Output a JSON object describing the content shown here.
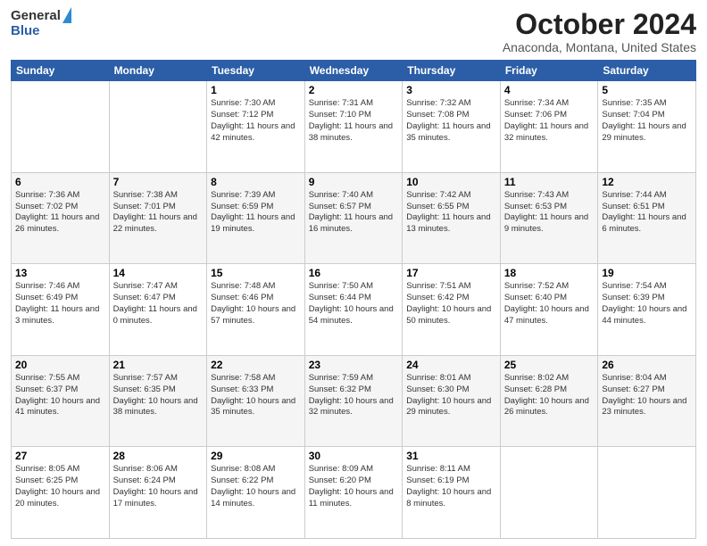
{
  "header": {
    "logo_general": "General",
    "logo_blue": "Blue",
    "title": "October 2024",
    "subtitle": "Anaconda, Montana, United States"
  },
  "days_of_week": [
    "Sunday",
    "Monday",
    "Tuesday",
    "Wednesday",
    "Thursday",
    "Friday",
    "Saturday"
  ],
  "weeks": [
    [
      {
        "day": "",
        "info": ""
      },
      {
        "day": "",
        "info": ""
      },
      {
        "day": "1",
        "info": "Sunrise: 7:30 AM\nSunset: 7:12 PM\nDaylight: 11 hours and 42 minutes."
      },
      {
        "day": "2",
        "info": "Sunrise: 7:31 AM\nSunset: 7:10 PM\nDaylight: 11 hours and 38 minutes."
      },
      {
        "day": "3",
        "info": "Sunrise: 7:32 AM\nSunset: 7:08 PM\nDaylight: 11 hours and 35 minutes."
      },
      {
        "day": "4",
        "info": "Sunrise: 7:34 AM\nSunset: 7:06 PM\nDaylight: 11 hours and 32 minutes."
      },
      {
        "day": "5",
        "info": "Sunrise: 7:35 AM\nSunset: 7:04 PM\nDaylight: 11 hours and 29 minutes."
      }
    ],
    [
      {
        "day": "6",
        "info": "Sunrise: 7:36 AM\nSunset: 7:02 PM\nDaylight: 11 hours and 26 minutes."
      },
      {
        "day": "7",
        "info": "Sunrise: 7:38 AM\nSunset: 7:01 PM\nDaylight: 11 hours and 22 minutes."
      },
      {
        "day": "8",
        "info": "Sunrise: 7:39 AM\nSunset: 6:59 PM\nDaylight: 11 hours and 19 minutes."
      },
      {
        "day": "9",
        "info": "Sunrise: 7:40 AM\nSunset: 6:57 PM\nDaylight: 11 hours and 16 minutes."
      },
      {
        "day": "10",
        "info": "Sunrise: 7:42 AM\nSunset: 6:55 PM\nDaylight: 11 hours and 13 minutes."
      },
      {
        "day": "11",
        "info": "Sunrise: 7:43 AM\nSunset: 6:53 PM\nDaylight: 11 hours and 9 minutes."
      },
      {
        "day": "12",
        "info": "Sunrise: 7:44 AM\nSunset: 6:51 PM\nDaylight: 11 hours and 6 minutes."
      }
    ],
    [
      {
        "day": "13",
        "info": "Sunrise: 7:46 AM\nSunset: 6:49 PM\nDaylight: 11 hours and 3 minutes."
      },
      {
        "day": "14",
        "info": "Sunrise: 7:47 AM\nSunset: 6:47 PM\nDaylight: 11 hours and 0 minutes."
      },
      {
        "day": "15",
        "info": "Sunrise: 7:48 AM\nSunset: 6:46 PM\nDaylight: 10 hours and 57 minutes."
      },
      {
        "day": "16",
        "info": "Sunrise: 7:50 AM\nSunset: 6:44 PM\nDaylight: 10 hours and 54 minutes."
      },
      {
        "day": "17",
        "info": "Sunrise: 7:51 AM\nSunset: 6:42 PM\nDaylight: 10 hours and 50 minutes."
      },
      {
        "day": "18",
        "info": "Sunrise: 7:52 AM\nSunset: 6:40 PM\nDaylight: 10 hours and 47 minutes."
      },
      {
        "day": "19",
        "info": "Sunrise: 7:54 AM\nSunset: 6:39 PM\nDaylight: 10 hours and 44 minutes."
      }
    ],
    [
      {
        "day": "20",
        "info": "Sunrise: 7:55 AM\nSunset: 6:37 PM\nDaylight: 10 hours and 41 minutes."
      },
      {
        "day": "21",
        "info": "Sunrise: 7:57 AM\nSunset: 6:35 PM\nDaylight: 10 hours and 38 minutes."
      },
      {
        "day": "22",
        "info": "Sunrise: 7:58 AM\nSunset: 6:33 PM\nDaylight: 10 hours and 35 minutes."
      },
      {
        "day": "23",
        "info": "Sunrise: 7:59 AM\nSunset: 6:32 PM\nDaylight: 10 hours and 32 minutes."
      },
      {
        "day": "24",
        "info": "Sunrise: 8:01 AM\nSunset: 6:30 PM\nDaylight: 10 hours and 29 minutes."
      },
      {
        "day": "25",
        "info": "Sunrise: 8:02 AM\nSunset: 6:28 PM\nDaylight: 10 hours and 26 minutes."
      },
      {
        "day": "26",
        "info": "Sunrise: 8:04 AM\nSunset: 6:27 PM\nDaylight: 10 hours and 23 minutes."
      }
    ],
    [
      {
        "day": "27",
        "info": "Sunrise: 8:05 AM\nSunset: 6:25 PM\nDaylight: 10 hours and 20 minutes."
      },
      {
        "day": "28",
        "info": "Sunrise: 8:06 AM\nSunset: 6:24 PM\nDaylight: 10 hours and 17 minutes."
      },
      {
        "day": "29",
        "info": "Sunrise: 8:08 AM\nSunset: 6:22 PM\nDaylight: 10 hours and 14 minutes."
      },
      {
        "day": "30",
        "info": "Sunrise: 8:09 AM\nSunset: 6:20 PM\nDaylight: 10 hours and 11 minutes."
      },
      {
        "day": "31",
        "info": "Sunrise: 8:11 AM\nSunset: 6:19 PM\nDaylight: 10 hours and 8 minutes."
      },
      {
        "day": "",
        "info": ""
      },
      {
        "day": "",
        "info": ""
      }
    ]
  ]
}
